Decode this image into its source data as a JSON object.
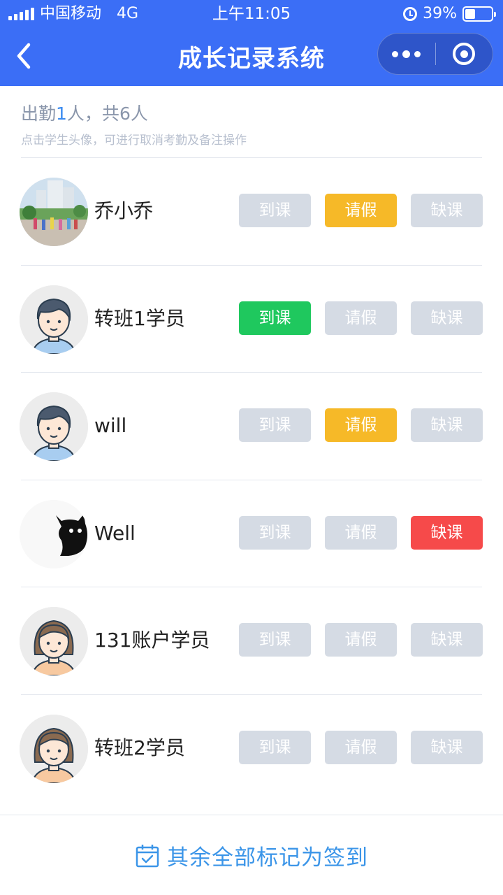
{
  "status_bar": {
    "carrier": "中国移动",
    "network": "4G",
    "time": "上午11:05",
    "battery_text": "39%",
    "battery_level": 0.39
  },
  "header": {
    "title": "成长记录系统",
    "back_icon": "chevron-left-icon",
    "more_icon": "more-dots-icon",
    "close_icon": "target-close-icon",
    "color": "#3b6ef6"
  },
  "summary": {
    "prefix": "出勤",
    "present_count": "1",
    "middle": "人，共",
    "total": "6",
    "suffix": "人",
    "hint": "点击学生头像，可进行取消考勤及备注操作"
  },
  "buttons": {
    "present": "到课",
    "leave": "请假",
    "absent": "缺课"
  },
  "status_colors": {
    "present": "#1fc85e",
    "leave": "#f6b928",
    "absent": "#f64a4a",
    "inactive": "#d5dbe4"
  },
  "students": [
    {
      "name": "乔小乔",
      "avatar": "photo-avatar",
      "status": "leave"
    },
    {
      "name": "转班1学员",
      "avatar": "boy-avatar",
      "status": "present"
    },
    {
      "name": "will",
      "avatar": "boy-avatar",
      "status": "leave"
    },
    {
      "name": "Well",
      "avatar": "cat-avatar",
      "status": "absent"
    },
    {
      "name": "131账户学员",
      "avatar": "girl-avatar",
      "status": "none"
    },
    {
      "name": "转班2学员",
      "avatar": "girl-avatar",
      "status": "none"
    }
  ],
  "footer": {
    "icon": "calendar-check-icon",
    "label": "其余全部标记为签到"
  }
}
